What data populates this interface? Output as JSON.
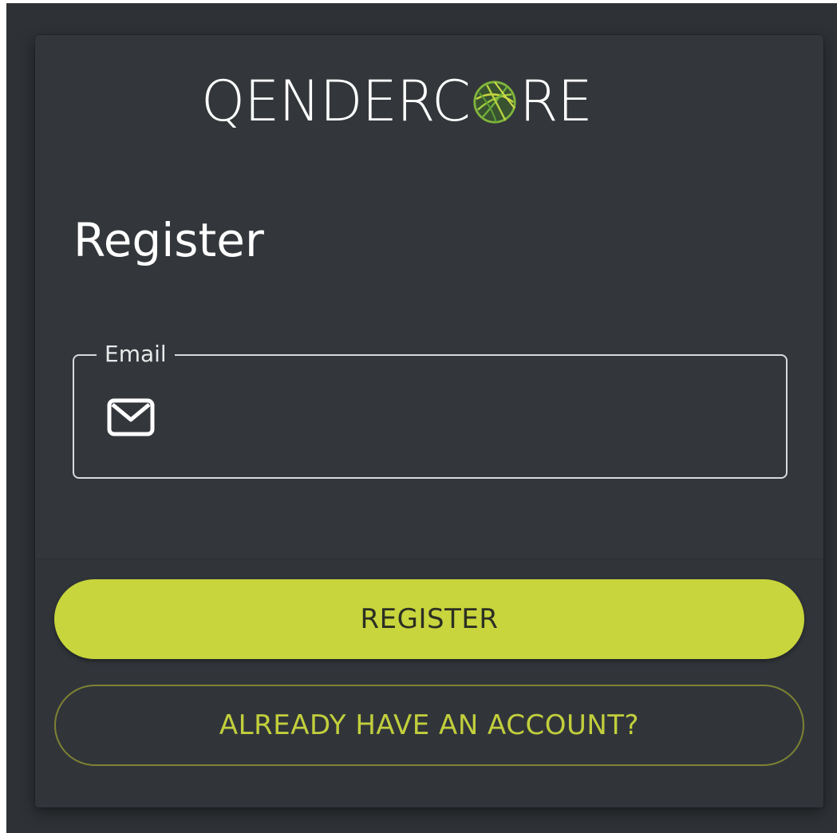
{
  "brand": {
    "logo_prefix": "QENDERC",
    "logo_suffix": "RE",
    "logo_full": "QENDERCORE"
  },
  "form": {
    "title": "Register",
    "email": {
      "label": "Email",
      "value": "",
      "placeholder": ""
    }
  },
  "actions": {
    "register_label": "REGISTER",
    "login_link_label": "ALREADY HAVE AN ACCOUNT?"
  },
  "icons": {
    "email": "mail-icon",
    "logo_o": "globe-icon"
  },
  "colors": {
    "background": "#2e3236",
    "card": "#33373b",
    "accent": "#c8d53c",
    "accent_text": "#c2cf3c",
    "accent_outline": "#7e8232"
  }
}
